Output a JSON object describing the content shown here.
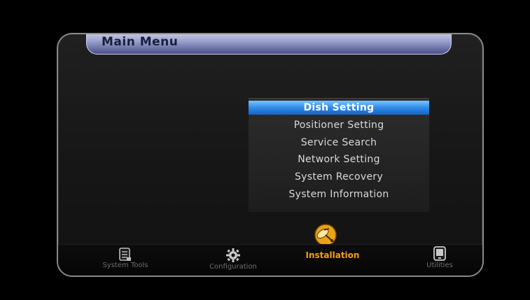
{
  "header": {
    "title": "Main Menu"
  },
  "menu": {
    "items": [
      {
        "label": "Dish Setting",
        "selected": true
      },
      {
        "label": "Positioner Setting",
        "selected": false
      },
      {
        "label": "Service Search",
        "selected": false
      },
      {
        "label": "Network Setting",
        "selected": false
      },
      {
        "label": "System Recovery",
        "selected": false
      },
      {
        "label": "System Information",
        "selected": false
      }
    ]
  },
  "bottom_nav": {
    "items": [
      {
        "label": "System Tools",
        "icon": "list-icon",
        "active": false
      },
      {
        "label": "Configuration",
        "icon": "gear-icon",
        "active": false
      },
      {
        "label": "Installation",
        "icon": "satellite-icon",
        "active": true
      },
      {
        "label": "Utilities",
        "icon": "device-icon",
        "active": false
      }
    ]
  },
  "colors": {
    "selected": "#1e7ad8",
    "active_nav": "#f0a010",
    "panel_border": "#8a8a8a"
  }
}
